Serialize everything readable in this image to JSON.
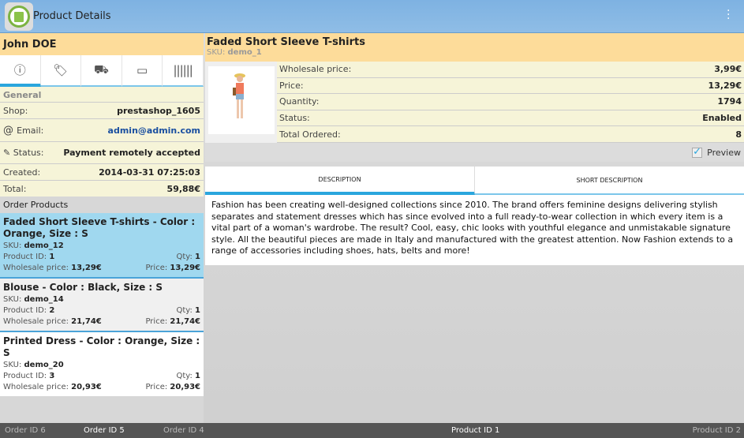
{
  "header": {
    "title": "Product Details"
  },
  "customer": {
    "name": "John DOE"
  },
  "tabs": [
    "info-icon",
    "tag-icon",
    "truck-icon",
    "credit-card-icon",
    "barcode-icon"
  ],
  "general": {
    "label": "General",
    "rows": [
      {
        "label": "Shop:",
        "value": "prestashop_1605"
      },
      {
        "label": "Email:",
        "value": "admin@admin.com"
      },
      {
        "label": "Status:",
        "value": "Payment remotely accepted"
      },
      {
        "label": "Created:",
        "value": "2014-03-31 07:25:03"
      },
      {
        "label": "Total:",
        "value": "59,88€"
      }
    ]
  },
  "order_products": {
    "label": "Order Products",
    "sku_label": "SKU:",
    "pid_label": "Product ID:",
    "qty_label": "Qty:",
    "wprice_label": "Wholesale price:",
    "price_label": "Price:",
    "items": [
      {
        "name": "Faded Short Sleeve T-shirts - Color : Orange, Size : S",
        "sku": "demo_12",
        "pid": "1",
        "qty": "1",
        "wprice": "13,29€",
        "price": "13,29€"
      },
      {
        "name": "Blouse - Color : Black, Size : S",
        "sku": "demo_14",
        "pid": "2",
        "qty": "1",
        "wprice": "21,74€",
        "price": "21,74€"
      },
      {
        "name": "Printed Dress - Color : Orange, Size : S",
        "sku": "demo_20",
        "pid": "3",
        "qty": "1",
        "wprice": "20,93€",
        "price": "20,93€"
      }
    ]
  },
  "product": {
    "name": "Faded Short Sleeve T-shirts",
    "sku_label": "SKU:",
    "sku": "demo_1",
    "props": [
      {
        "label": "Wholesale price:",
        "value": "3,99€"
      },
      {
        "label": "Price:",
        "value": "13,29€"
      },
      {
        "label": "Quantity:",
        "value": "1794"
      },
      {
        "label": "Status:",
        "value": "Enabled"
      },
      {
        "label": "Total Ordered:",
        "value": "8"
      }
    ],
    "preview_label": "Preview",
    "preview_checked": true,
    "tabs": [
      "DESCRIPTION",
      "SHORT DESCRIPTION"
    ],
    "description": "Fashion has been creating well-designed collections since 2010. The brand offers feminine designs delivering stylish separates and statement dresses which has since evolved into a full ready-to-wear collection in which every item is a vital part of a woman's wardrobe. The result? Cool, easy, chic looks with youthful elegance and unmistakable signature style. All the beautiful pieces are made in Italy and manufactured with the greatest attention. Now Fashion extends to a range of accessories including shoes, hats, belts and more!"
  },
  "bottom": {
    "left": [
      "Order ID 6",
      "Order ID 5",
      "Order ID 4"
    ],
    "right": [
      "Product ID 1",
      "Product ID 2"
    ]
  }
}
